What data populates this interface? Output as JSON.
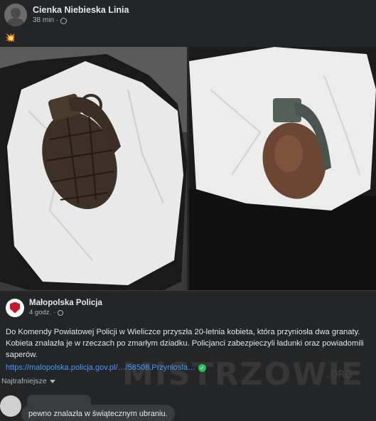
{
  "post": {
    "page_name": "Cienka Niebieska Linia",
    "time": "38 min",
    "privacy_icon": "globe-icon",
    "emoji": "collision-emoji"
  },
  "shared_post": {
    "page_name": "Małopolska Policja",
    "time": "4 godz.",
    "privacy_icon": "globe-icon",
    "text": "Do Komendy Powiatowej Policji w Wieliczce przyszła 20-letnia kobieta, która przyniosła dwa granaty. Kobieta znalazła je w rzeczach po zmarłym dziadku. Policjanci zabezpieczyli ładunki oraz powiadomili saperów.",
    "link": "https://malopolska.policja.gov.pl/…/58508,Przyniosla…",
    "verified_icon": "check-circle-icon"
  },
  "watermark": {
    "text": "MISTRZOWIE",
    "suffix": ".ORG"
  },
  "comments": {
    "sort_label": "Najtrafniejsze",
    "items": [
      {
        "text": "pewno znalazła w świątecznym ubraniu."
      }
    ]
  },
  "colors": {
    "background": "#242526",
    "link": "#4599ff",
    "verified": "#2abf5a"
  }
}
